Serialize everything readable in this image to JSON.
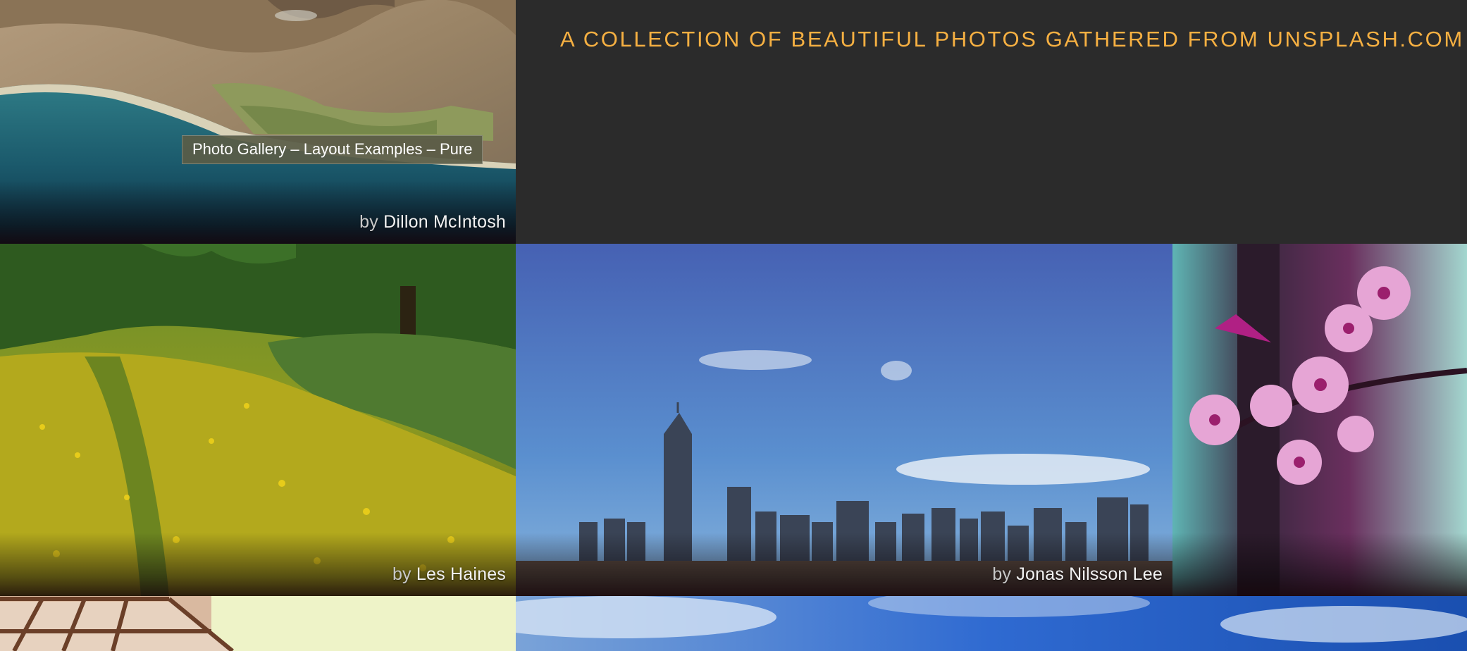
{
  "intro": {
    "text": "A COLLECTION OF BEAUTIFUL PHOTOS GATHERED FROM UNSPLASH.COM"
  },
  "tooltip": {
    "text": "Photo Gallery – Layout Examples – Pure"
  },
  "photos": [
    {
      "by": "by",
      "author": "Dillon McIntosh"
    },
    {
      "by": "by",
      "author": "Les Haines"
    },
    {
      "by": "by",
      "author": "Jonas Nilsson Lee"
    }
  ],
  "colors": {
    "accent": "#f6b042",
    "background": "#2a2a2a"
  }
}
